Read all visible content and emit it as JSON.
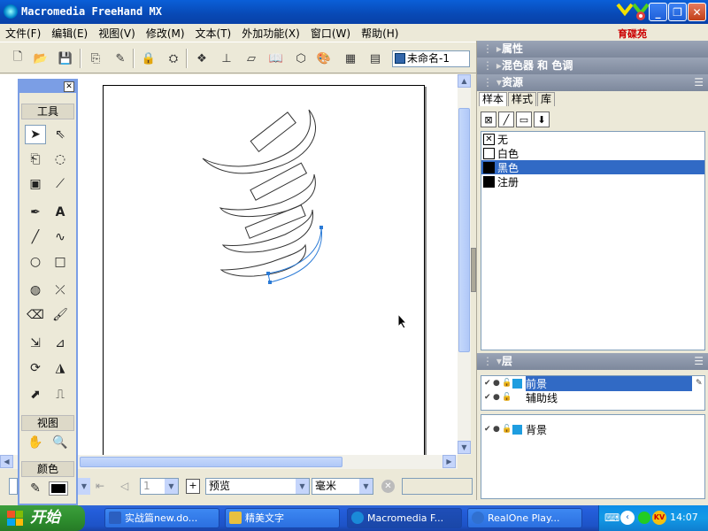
{
  "window": {
    "title": "Macromedia FreeHand MX",
    "logo_text": "育碟苑",
    "controls": [
      "_",
      "❐",
      "✕"
    ]
  },
  "menubar": {
    "items": [
      "文件(F)",
      "编辑(E)",
      "视图(V)",
      "修改(M)",
      "文本(T)",
      "外加功能(X)",
      "窗口(W)",
      "帮助(H)"
    ]
  },
  "toolbar": {
    "doc_name": "未命名-1"
  },
  "tools_panel": {
    "title": "工具",
    "view_label": "视图",
    "color_label": "颜色"
  },
  "statusbar": {
    "page_number": "1",
    "view_mode": "预览",
    "units": "毫米"
  },
  "right_panel": {
    "properties": "属性",
    "mixer": "混色器 和 色调",
    "assets": "资源",
    "tabs": [
      "样本",
      "样式",
      "库"
    ],
    "swatches": [
      {
        "name": "无",
        "color": "none"
      },
      {
        "name": "白色",
        "color": "#ffffff"
      },
      {
        "name": "黑色",
        "color": "#000000",
        "selected": true
      },
      {
        "name": "注册",
        "color": "#000000"
      }
    ],
    "layers_title": "层",
    "layers": [
      {
        "name": "前景",
        "selected": true
      },
      {
        "name": "辅助线"
      }
    ],
    "background_layer": "背景"
  },
  "taskbar": {
    "start": "开始",
    "tasks": [
      {
        "label": "实战篇new.do...",
        "color": "#2b5fc0"
      },
      {
        "label": "精美文字",
        "color": "#e8c040"
      },
      {
        "label": "Macromedia F...",
        "color": "#1a8ad8",
        "active": true
      },
      {
        "label": "RealOne Play...",
        "color": "#3070d0"
      }
    ],
    "clock": "14:07"
  }
}
